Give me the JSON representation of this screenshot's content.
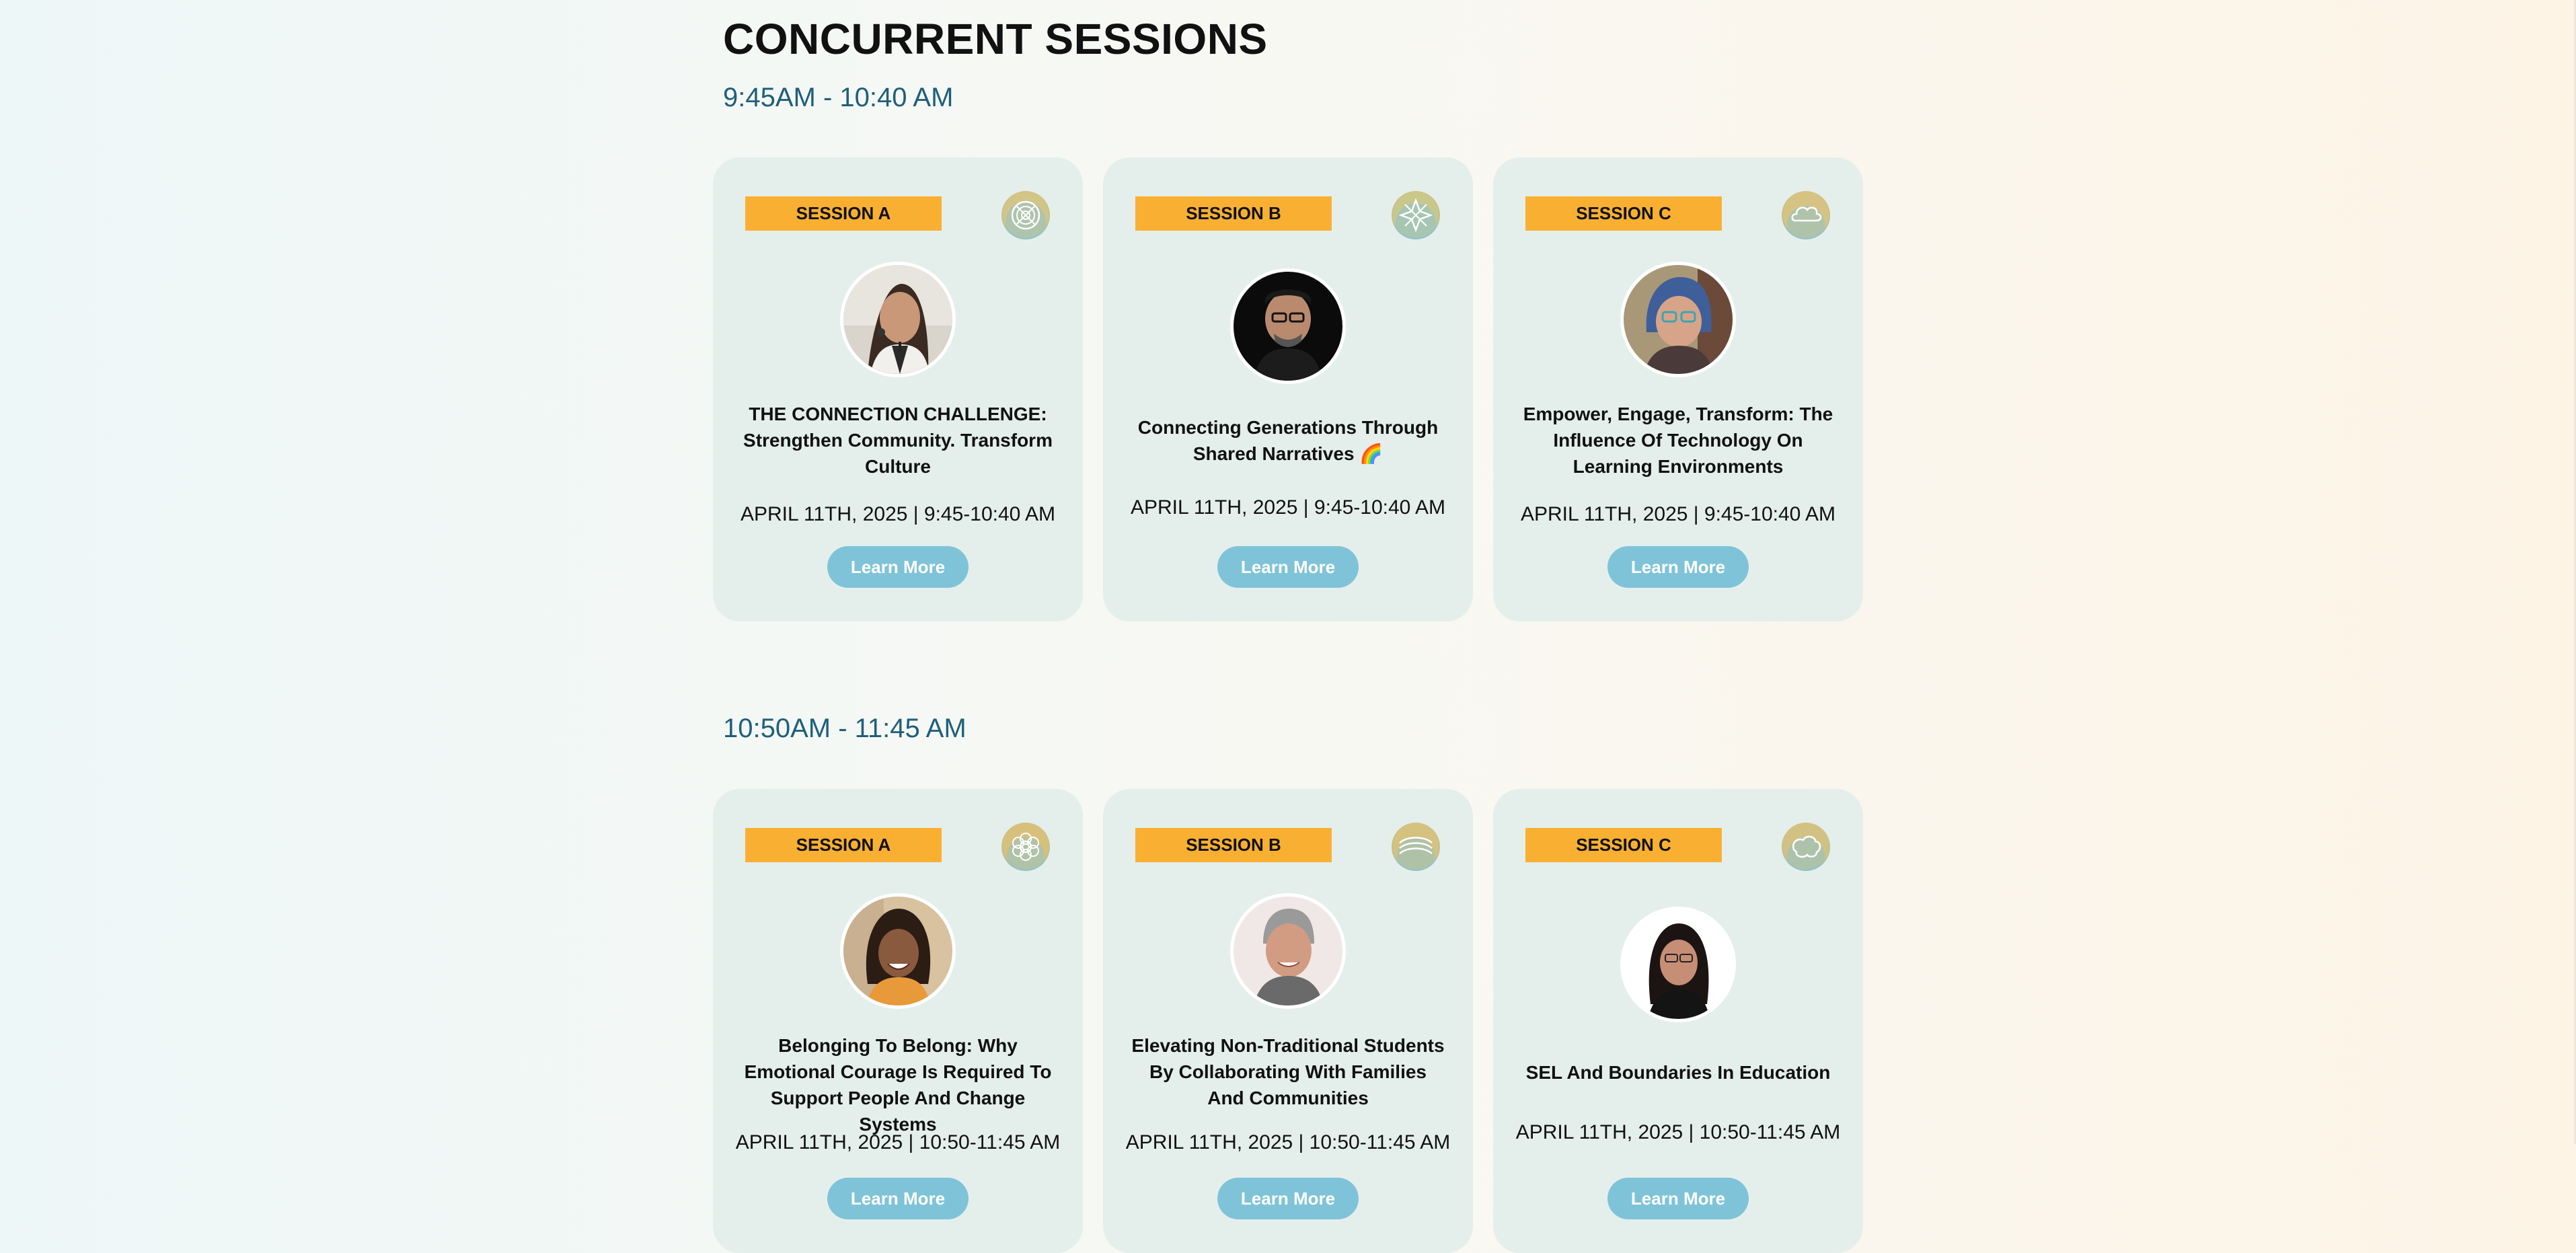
{
  "page_title": "CONCURRENT SESSIONS",
  "accent_colors": {
    "timeslot": "#1f5f7a",
    "badge": "#f9b032",
    "card": "#e4efec",
    "button": "#7fc3d8"
  },
  "timeslots": [
    {
      "label": "9:45AM - 10:40 AM",
      "sessions": [
        {
          "badge": "SESSION A",
          "icon": "mandala-topic-icon",
          "avatar": "speaker-avatar-woman-earrings",
          "title": "THE CONNECTION CHALLENGE: Strengthen Community. Transform Culture",
          "date": "APRIL 11TH, 2025 | 9:45-10:40 AM",
          "button": "Learn More"
        },
        {
          "badge": "SESSION B",
          "icon": "star-topic-icon",
          "avatar": "speaker-avatar-man-glasses",
          "title": "Connecting Generations Through Shared Narratives 🌈",
          "date": "APRIL 11TH, 2025 | 9:45-10:40 AM",
          "button": "Learn More"
        },
        {
          "badge": "SESSION C",
          "icon": "cloud-topic-icon",
          "avatar": "speaker-avatar-woman-blue-hair",
          "title": "Empower, Engage, Transform: The Influence Of Technology On Learning Environments",
          "date": "APRIL 11TH, 2025 | 9:45-10:40 AM",
          "button": "Learn More"
        }
      ]
    },
    {
      "label": "10:50AM - 11:45 AM",
      "sessions": [
        {
          "badge": "SESSION A",
          "icon": "flower-topic-icon",
          "avatar": "speaker-avatar-woman-locs",
          "title": "Belonging To Belong: Why Emotional Courage Is Required To Support People And Change Systems",
          "date": "APRIL 11TH, 2025 | 10:50-11:45 AM",
          "button": "Learn More"
        },
        {
          "badge": "SESSION B",
          "icon": "swirl-topic-icon",
          "avatar": "speaker-avatar-man-gray-hair",
          "title": "Elevating Non-Traditional Students By Collaborating With Families And Communities",
          "date": "APRIL 11TH, 2025 | 10:50-11:45 AM",
          "button": "Learn More"
        },
        {
          "badge": "SESSION C",
          "icon": "brain-topic-icon",
          "avatar": "speaker-avatar-woman-dark-hair",
          "title": "SEL And Boundaries In Education",
          "date": "APRIL 11TH, 2025 | 10:50-11:45 AM",
          "button": "Learn More"
        }
      ]
    }
  ]
}
